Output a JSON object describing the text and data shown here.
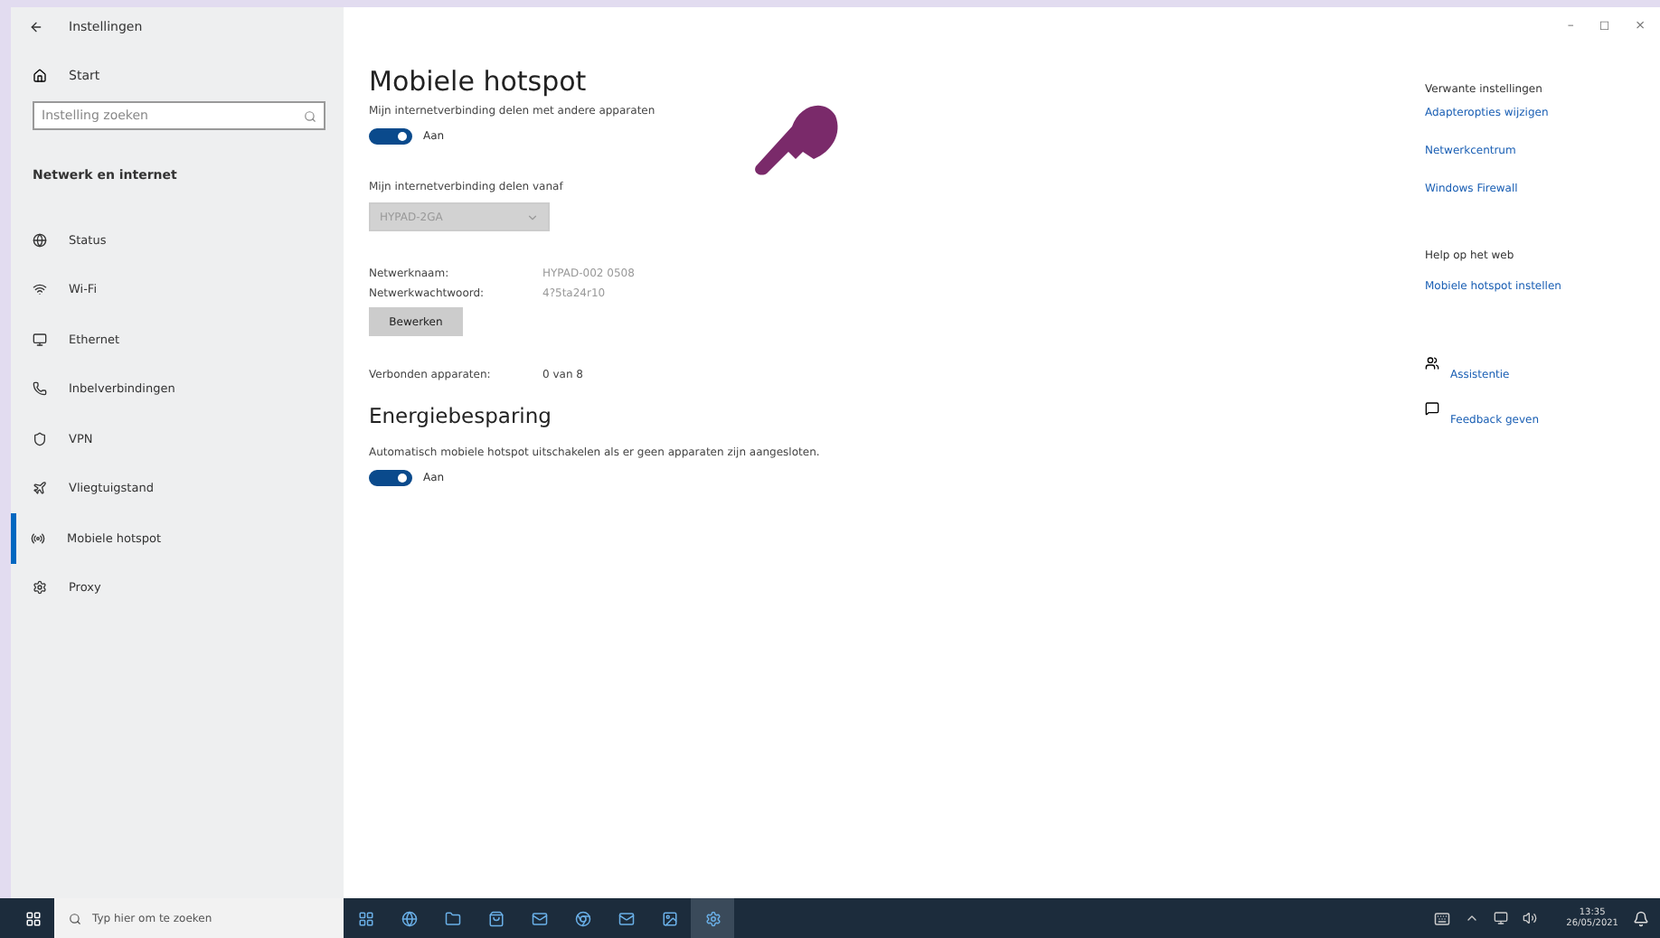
{
  "window": {
    "title": "Instellingen",
    "controls": [
      "–",
      "◻",
      "×"
    ]
  },
  "sidebar": {
    "home": "Start",
    "search": {
      "placeholder": "Instelling zoeken"
    },
    "section": "Netwerk en internet",
    "items": [
      {
        "label": "Status",
        "selected": false
      },
      {
        "label": "Wi-Fi",
        "selected": false
      },
      {
        "label": "Ethernet",
        "selected": false
      },
      {
        "label": "Inbelverbindingen",
        "selected": false
      },
      {
        "label": "VPN",
        "selected": false
      },
      {
        "label": "Vliegtuigstand",
        "selected": false
      },
      {
        "label": "Mobiele hotspot",
        "selected": true
      },
      {
        "label": "Proxy",
        "selected": false
      }
    ]
  },
  "main": {
    "title": "Mobiele hotspot",
    "share": {
      "label": "Mijn internetverbinding delen met andere apparaten",
      "on": true,
      "state": "Aan"
    },
    "source": {
      "label": "Mijn internetverbinding delen vanaf",
      "value": "HYPAD-2GA",
      "disabled": true
    },
    "details": [
      {
        "label": "Netwerknaam:",
        "value": "HYPAD-002 0508"
      },
      {
        "label": "Netwerkwachtwoord:",
        "value": "4?5ta24r10"
      }
    ],
    "edit_button": "Bewerken",
    "connected": {
      "label": "Verbonden apparaten:",
      "value": "0 van 8"
    },
    "power_title": "Energiebesparing",
    "power": {
      "label": "Automatisch mobiele hotspot uitschakelen als er geen apparaten zijn aangesloten.",
      "on": true,
      "state": "Aan"
    }
  },
  "related": {
    "title": "Verwante instellingen",
    "links": [
      "Adapteropties wijzigen",
      "Netwerkcentrum",
      "Windows Firewall"
    ],
    "help_title": "Help op het web",
    "help_links": [
      "Mobiele hotspot instellen"
    ],
    "actions": [
      {
        "kind": "assist",
        "label": "Assistentie"
      },
      {
        "kind": "feedback",
        "label": "Feedback geven"
      }
    ]
  },
  "taskbar": {
    "search": {
      "placeholder": "Typ hier om te zoeken"
    },
    "time": "13:35",
    "date": "26/05/2021"
  }
}
